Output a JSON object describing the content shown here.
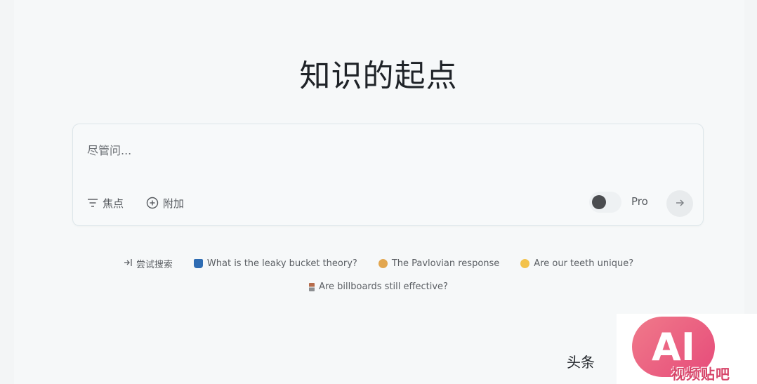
{
  "page": {
    "title": "知识的起点"
  },
  "search": {
    "placeholder": "尽管问...",
    "value": "",
    "focus_label": "焦点",
    "attach_label": "附加",
    "pro_label": "Pro",
    "pro_enabled": false
  },
  "suggestions": {
    "label": "尝试搜索",
    "items": [
      {
        "icon": "bucket-icon",
        "text": "What is the leaky bucket theory?"
      },
      {
        "icon": "dog-icon",
        "text": "The Pavlovian response"
      },
      {
        "icon": "tooth-icon",
        "text": "Are our teeth unique?"
      },
      {
        "icon": "billboard-icon",
        "text": "Are billboards still effective?"
      }
    ]
  },
  "footer": {
    "text": "头条"
  },
  "watermark": {
    "logo_text": "AI",
    "sub_text": "视频贴吧"
  },
  "colors": {
    "background": "#f6f8f9",
    "title": "#1f2328",
    "accent_watermark": "#e64b7a"
  }
}
